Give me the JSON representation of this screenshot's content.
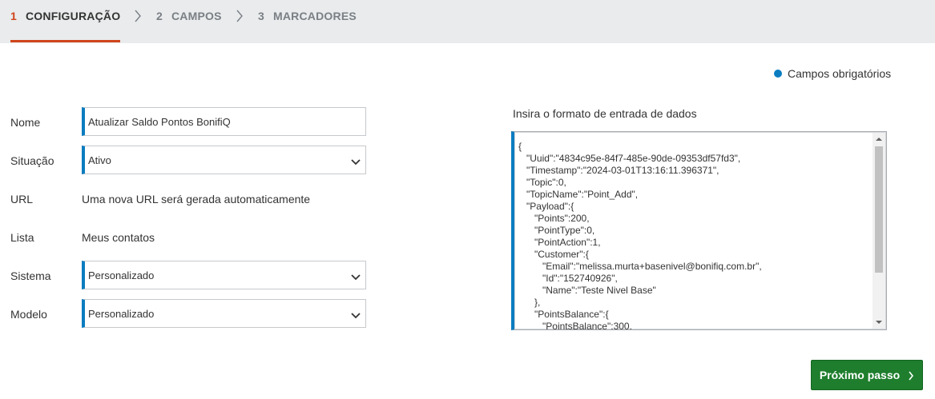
{
  "stepper": {
    "steps": [
      {
        "num": "1",
        "label": "CONFIGURAÇÃO",
        "active": true
      },
      {
        "num": "2",
        "label": "CAMPOS",
        "active": false
      },
      {
        "num": "3",
        "label": "MARCADORES",
        "active": false
      }
    ]
  },
  "required_legend": "Campos obrigatórios",
  "colors": {
    "accent": "#0a7cc0",
    "active_step": "#d0451b",
    "primary_button": "#1e7e2d"
  },
  "form": {
    "nome": {
      "label": "Nome",
      "value": "Atualizar Saldo Pontos BonifiQ"
    },
    "situacao": {
      "label": "Situação",
      "value": "Ativo"
    },
    "url": {
      "label": "URL",
      "value": "Uma nova URL será gerada automaticamente"
    },
    "lista": {
      "label": "Lista",
      "value": "Meus contatos"
    },
    "sistema": {
      "label": "Sistema",
      "value": "Personalizado"
    },
    "modelo": {
      "label": "Modelo",
      "value": "Personalizado"
    }
  },
  "data_input": {
    "title": "Insira o formato de entrada de dados",
    "content": "{\n   \"Uuid\":\"4834c95e-84f7-485e-90de-09353df57fd3\",\n   \"Timestamp\":\"2024-03-01T13:16:11.396371\",\n   \"Topic\":0,\n   \"TopicName\":\"Point_Add\",\n   \"Payload\":{\n      \"Points\":200,\n      \"PointType\":0,\n      \"PointAction\":1,\n      \"Customer\":{\n         \"Email\":\"melissa.murta+basenivel@bonifiq.com.br\",\n         \"Id\":\"152740926\",\n         \"Name\":\"Teste Nivel Base\"\n      },\n      \"PointsBalance\":{\n         \"PointsBalance\":300,"
  },
  "next_button": {
    "label": "Próximo passo",
    "icon": "chevron-right-icon"
  }
}
